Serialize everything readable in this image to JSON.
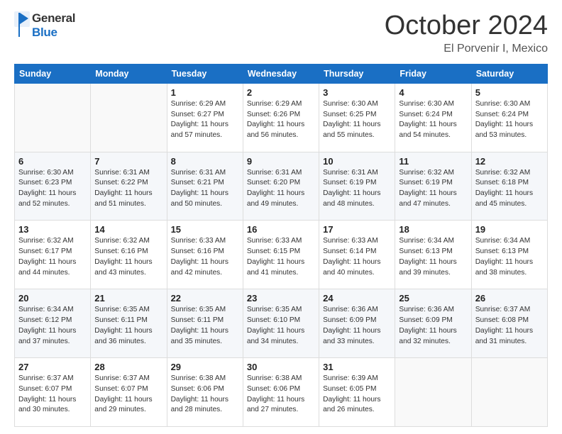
{
  "header": {
    "logo_line1": "General",
    "logo_line2": "Blue",
    "month": "October 2024",
    "location": "El Porvenir I, Mexico"
  },
  "weekdays": [
    "Sunday",
    "Monday",
    "Tuesday",
    "Wednesday",
    "Thursday",
    "Friday",
    "Saturday"
  ],
  "weeks": [
    [
      {
        "day": "",
        "info": ""
      },
      {
        "day": "",
        "info": ""
      },
      {
        "day": "1",
        "info": "Sunrise: 6:29 AM\nSunset: 6:27 PM\nDaylight: 11 hours and 57 minutes."
      },
      {
        "day": "2",
        "info": "Sunrise: 6:29 AM\nSunset: 6:26 PM\nDaylight: 11 hours and 56 minutes."
      },
      {
        "day": "3",
        "info": "Sunrise: 6:30 AM\nSunset: 6:25 PM\nDaylight: 11 hours and 55 minutes."
      },
      {
        "day": "4",
        "info": "Sunrise: 6:30 AM\nSunset: 6:24 PM\nDaylight: 11 hours and 54 minutes."
      },
      {
        "day": "5",
        "info": "Sunrise: 6:30 AM\nSunset: 6:24 PM\nDaylight: 11 hours and 53 minutes."
      }
    ],
    [
      {
        "day": "6",
        "info": "Sunrise: 6:30 AM\nSunset: 6:23 PM\nDaylight: 11 hours and 52 minutes."
      },
      {
        "day": "7",
        "info": "Sunrise: 6:31 AM\nSunset: 6:22 PM\nDaylight: 11 hours and 51 minutes."
      },
      {
        "day": "8",
        "info": "Sunrise: 6:31 AM\nSunset: 6:21 PM\nDaylight: 11 hours and 50 minutes."
      },
      {
        "day": "9",
        "info": "Sunrise: 6:31 AM\nSunset: 6:20 PM\nDaylight: 11 hours and 49 minutes."
      },
      {
        "day": "10",
        "info": "Sunrise: 6:31 AM\nSunset: 6:19 PM\nDaylight: 11 hours and 48 minutes."
      },
      {
        "day": "11",
        "info": "Sunrise: 6:32 AM\nSunset: 6:19 PM\nDaylight: 11 hours and 47 minutes."
      },
      {
        "day": "12",
        "info": "Sunrise: 6:32 AM\nSunset: 6:18 PM\nDaylight: 11 hours and 45 minutes."
      }
    ],
    [
      {
        "day": "13",
        "info": "Sunrise: 6:32 AM\nSunset: 6:17 PM\nDaylight: 11 hours and 44 minutes."
      },
      {
        "day": "14",
        "info": "Sunrise: 6:32 AM\nSunset: 6:16 PM\nDaylight: 11 hours and 43 minutes."
      },
      {
        "day": "15",
        "info": "Sunrise: 6:33 AM\nSunset: 6:16 PM\nDaylight: 11 hours and 42 minutes."
      },
      {
        "day": "16",
        "info": "Sunrise: 6:33 AM\nSunset: 6:15 PM\nDaylight: 11 hours and 41 minutes."
      },
      {
        "day": "17",
        "info": "Sunrise: 6:33 AM\nSunset: 6:14 PM\nDaylight: 11 hours and 40 minutes."
      },
      {
        "day": "18",
        "info": "Sunrise: 6:34 AM\nSunset: 6:13 PM\nDaylight: 11 hours and 39 minutes."
      },
      {
        "day": "19",
        "info": "Sunrise: 6:34 AM\nSunset: 6:13 PM\nDaylight: 11 hours and 38 minutes."
      }
    ],
    [
      {
        "day": "20",
        "info": "Sunrise: 6:34 AM\nSunset: 6:12 PM\nDaylight: 11 hours and 37 minutes."
      },
      {
        "day": "21",
        "info": "Sunrise: 6:35 AM\nSunset: 6:11 PM\nDaylight: 11 hours and 36 minutes."
      },
      {
        "day": "22",
        "info": "Sunrise: 6:35 AM\nSunset: 6:11 PM\nDaylight: 11 hours and 35 minutes."
      },
      {
        "day": "23",
        "info": "Sunrise: 6:35 AM\nSunset: 6:10 PM\nDaylight: 11 hours and 34 minutes."
      },
      {
        "day": "24",
        "info": "Sunrise: 6:36 AM\nSunset: 6:09 PM\nDaylight: 11 hours and 33 minutes."
      },
      {
        "day": "25",
        "info": "Sunrise: 6:36 AM\nSunset: 6:09 PM\nDaylight: 11 hours and 32 minutes."
      },
      {
        "day": "26",
        "info": "Sunrise: 6:37 AM\nSunset: 6:08 PM\nDaylight: 11 hours and 31 minutes."
      }
    ],
    [
      {
        "day": "27",
        "info": "Sunrise: 6:37 AM\nSunset: 6:07 PM\nDaylight: 11 hours and 30 minutes."
      },
      {
        "day": "28",
        "info": "Sunrise: 6:37 AM\nSunset: 6:07 PM\nDaylight: 11 hours and 29 minutes."
      },
      {
        "day": "29",
        "info": "Sunrise: 6:38 AM\nSunset: 6:06 PM\nDaylight: 11 hours and 28 minutes."
      },
      {
        "day": "30",
        "info": "Sunrise: 6:38 AM\nSunset: 6:06 PM\nDaylight: 11 hours and 27 minutes."
      },
      {
        "day": "31",
        "info": "Sunrise: 6:39 AM\nSunset: 6:05 PM\nDaylight: 11 hours and 26 minutes."
      },
      {
        "day": "",
        "info": ""
      },
      {
        "day": "",
        "info": ""
      }
    ]
  ]
}
